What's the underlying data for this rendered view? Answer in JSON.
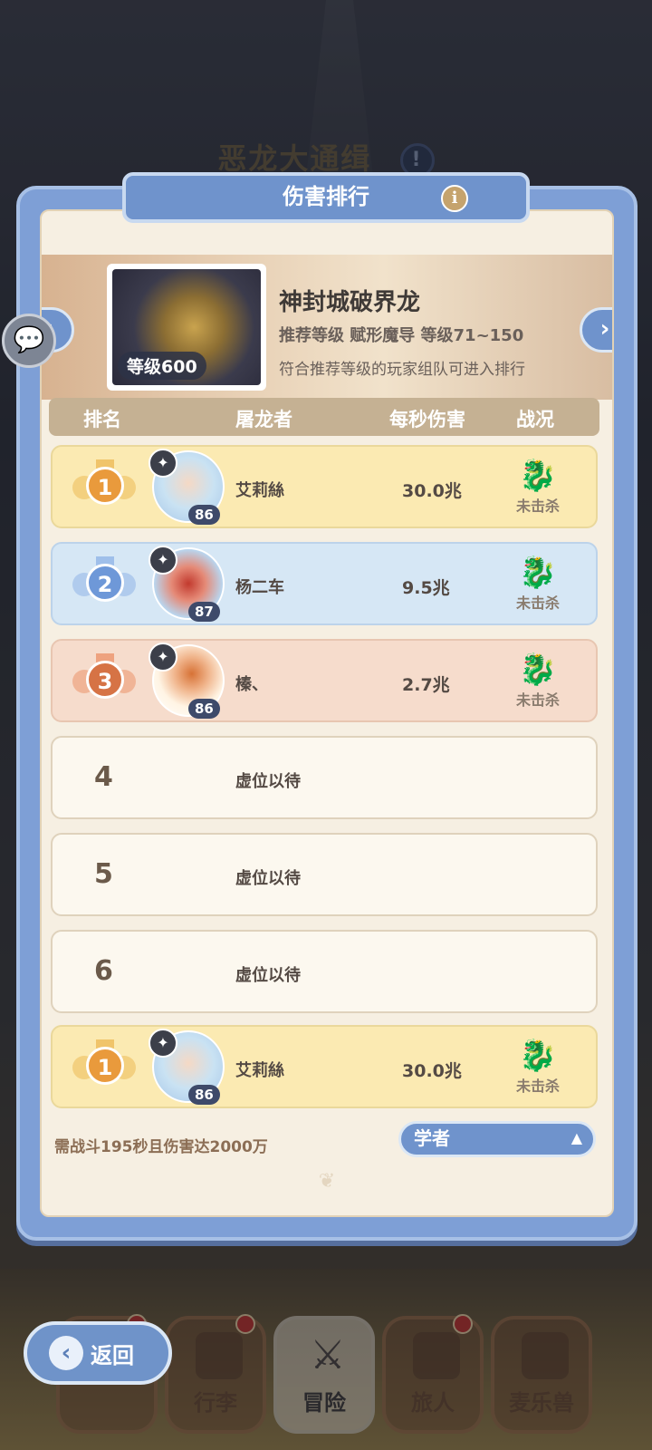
{
  "background": {
    "title": "恶龙大通缉",
    "title_badge": "!"
  },
  "panel": {
    "title": "伤害排行",
    "info_icon": "i",
    "boss": {
      "name": "神封城破界龙",
      "level_badge": "等级600",
      "recommend": "推荐等级 赋形魔导 等级71~150",
      "note": "符合推荐等级的玩家组队可进入排行"
    },
    "prev_arrow": "‹",
    "next_arrow": "›",
    "headers": {
      "rank": "排名",
      "slayer": "屠龙者",
      "dps": "每秒伤害",
      "status": "战况"
    },
    "rows": [
      {
        "rank": "1",
        "name": "艾莉絲",
        "level": "86",
        "dps": "30.0兆",
        "status": "未击杀",
        "tier": "gold"
      },
      {
        "rank": "2",
        "name": "杨二车",
        "level": "87",
        "dps": "9.5兆",
        "status": "未击杀",
        "tier": "silver"
      },
      {
        "rank": "3",
        "name": "榛、",
        "level": "86",
        "dps": "2.7兆",
        "status": "未击杀",
        "tier": "bronze"
      },
      {
        "rank": "4",
        "name": "虚位以待"
      },
      {
        "rank": "5",
        "name": "虚位以待"
      },
      {
        "rank": "6",
        "name": "虚位以待"
      }
    ],
    "my_row": {
      "rank": "1",
      "name": "艾莉絲",
      "level": "86",
      "dps": "30.0兆",
      "status": "未击杀"
    },
    "footer_note": "需战斗195秒且伤害达2000万",
    "class_select": {
      "value": "学者"
    }
  },
  "bottom_nav": {
    "back": "返回",
    "tabs": [
      "行李",
      "冒险",
      "旅人",
      "麦乐兽"
    ]
  }
}
